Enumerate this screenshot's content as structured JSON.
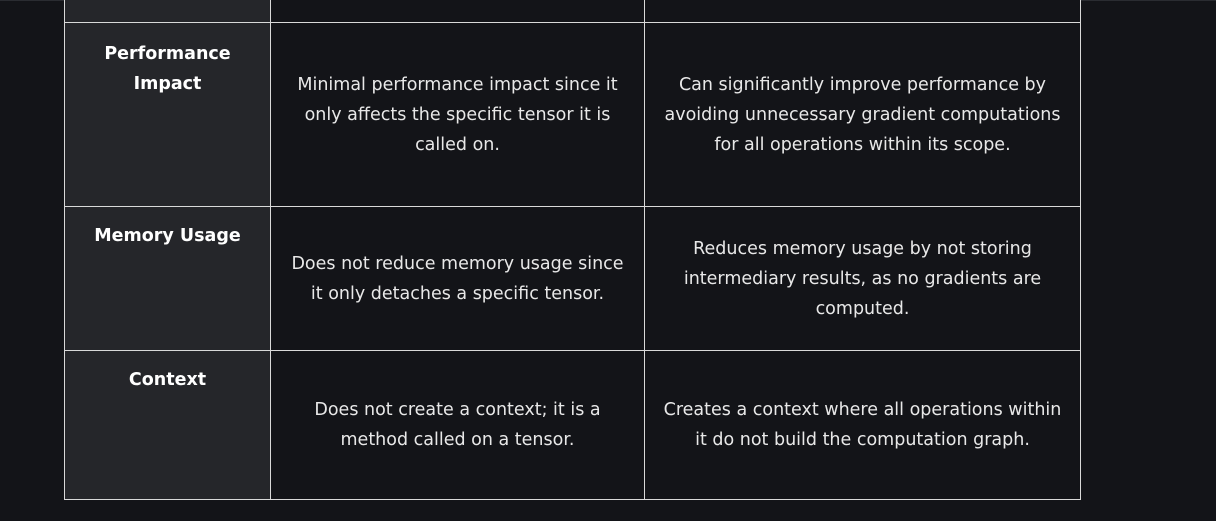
{
  "table": {
    "rows": [
      {
        "feature": "Performance Impact",
        "left": "Minimal performance impact since it only affects the specific tensor it is called on.",
        "right": "Can significantly improve performance by avoiding unnecessary gradient computations for all operations within its scope."
      },
      {
        "feature": "Memory Usage",
        "left": "Does not reduce memory usage since it only detaches a specific tensor.",
        "right": "Reduces memory usage by not storing intermediary results, as no gradients are computed."
      },
      {
        "feature": "Context",
        "left": "Does not create a context; it is a method called on a tensor.",
        "right": "Creates a context where all operations within it do not build the computation graph."
      }
    ]
  }
}
